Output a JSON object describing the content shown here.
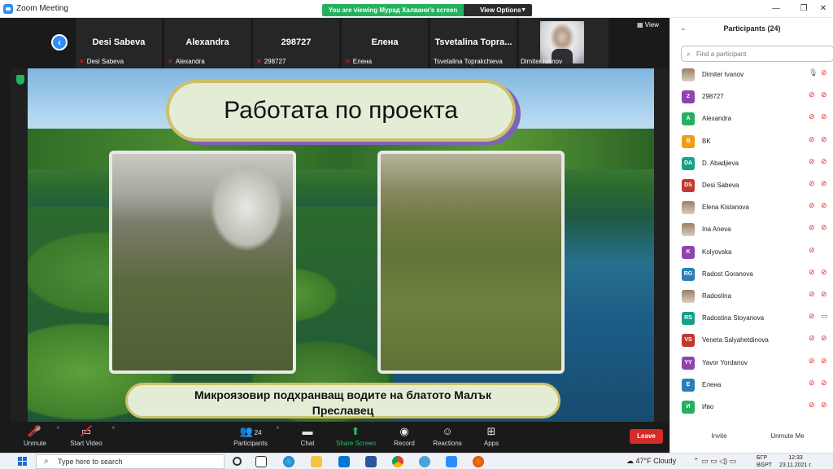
{
  "window": {
    "title": "Zoom Meeting",
    "viewing_banner": "You are viewing Мурад Халвани's screen",
    "view_options": "View Options"
  },
  "gallery": {
    "tiles": [
      {
        "big": "Desi Sabeva",
        "small": "Desi Sabeva"
      },
      {
        "big": "Alexandra",
        "small": "Alexandra"
      },
      {
        "big": "298727",
        "small": "298727"
      },
      {
        "big": "Елена",
        "small": "Елена"
      },
      {
        "big": "Tsvetalina  Topra...",
        "small": "Tsvetalina Toprakchieva"
      },
      {
        "big": "",
        "small": "Dimiter Ivanov"
      }
    ],
    "view_label": "View"
  },
  "slide": {
    "title": "Работата по проекта",
    "caption_line1": "Микроязовир подхранващ водите на блатото Малък",
    "caption_line2": "Преславец"
  },
  "toolbar": {
    "unmute": "Unmute",
    "start_video": "Start Video",
    "participants": "Participants",
    "participants_count": "24",
    "chat": "Chat",
    "share_screen": "Share Screen",
    "record": "Record",
    "reactions": "Reactions",
    "apps": "Apps",
    "leave": "Leave"
  },
  "panel": {
    "title": "Participants (24)",
    "search_placeholder": "Find a participant",
    "participants": [
      {
        "initials": "",
        "name": "Dimiter Ivanov",
        "color": "#8a7a6a",
        "mic": "on",
        "video": "off"
      },
      {
        "initials": "2",
        "name": "298727",
        "color": "#8e44ad",
        "mic": "off",
        "video": "off"
      },
      {
        "initials": "A",
        "name": "Alexandra",
        "color": "#27ae60",
        "mic": "off",
        "video": "off"
      },
      {
        "initials": "B",
        "name": "BK",
        "color": "#f39c12",
        "mic": "off",
        "video": "off"
      },
      {
        "initials": "DA",
        "name": "D. Abadjieva",
        "color": "#16a085",
        "mic": "off",
        "video": "off"
      },
      {
        "initials": "DS",
        "name": "Desi Sabeva",
        "color": "#c0392b",
        "mic": "off",
        "video": "off"
      },
      {
        "initials": "",
        "name": "Elena Kistanova",
        "color": "#8a7a6a",
        "mic": "off",
        "video": "off"
      },
      {
        "initials": "",
        "name": "Ina Aneva",
        "color": "#8a7a6a",
        "mic": "off",
        "video": "off"
      },
      {
        "initials": "K",
        "name": "Kolyovska",
        "color": "#8e44ad",
        "mic": "off",
        "video": "none"
      },
      {
        "initials": "RG",
        "name": "Radost Goranova",
        "color": "#2980b9",
        "mic": "off",
        "video": "off"
      },
      {
        "initials": "",
        "name": "Radostina",
        "color": "#8a7a6a",
        "mic": "off",
        "video": "off"
      },
      {
        "initials": "RS",
        "name": "Radostina Stoyanova",
        "color": "#16a085",
        "mic": "off",
        "video": "on"
      },
      {
        "initials": "VS",
        "name": "Veneta Salyahetdinova",
        "color": "#c0392b",
        "mic": "off",
        "video": "off"
      },
      {
        "initials": "YY",
        "name": "Yavor Yordanov",
        "color": "#8e44ad",
        "mic": "off",
        "video": "off"
      },
      {
        "initials": "Е",
        "name": "Елена",
        "color": "#2980b9",
        "mic": "off",
        "video": "off"
      },
      {
        "initials": "И",
        "name": "Иво",
        "color": "#27ae60",
        "mic": "off",
        "video": "off"
      }
    ],
    "invite": "Invite",
    "unmute_me": "Unmute Me"
  },
  "taskbar": {
    "search_placeholder": "Type here to search",
    "weather": "47°F  Cloudy",
    "lang_top": "БГР",
    "lang_bottom": "BGPT",
    "time": "12:33",
    "date": "23.11.2021 г."
  }
}
